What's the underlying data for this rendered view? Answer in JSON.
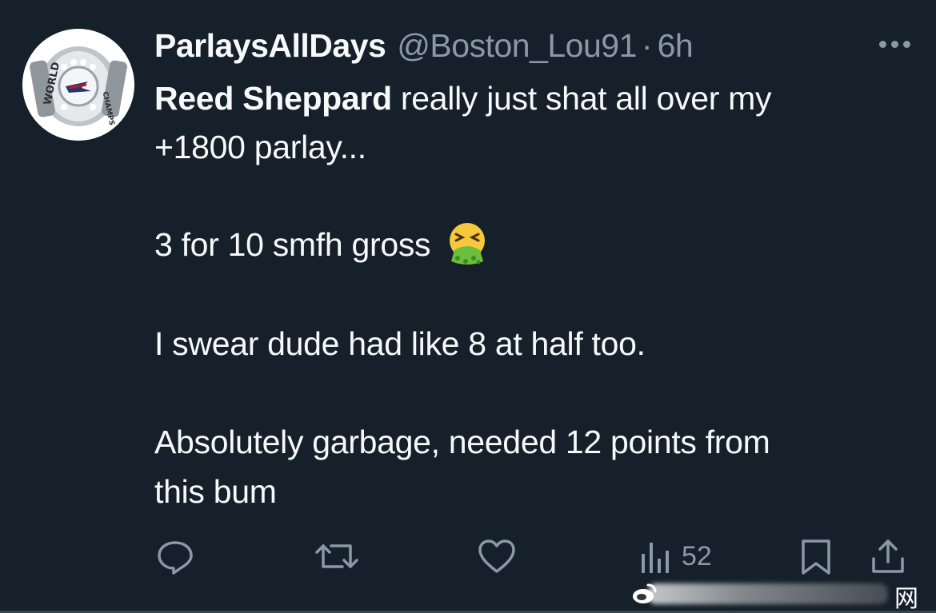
{
  "user": {
    "display_name": "ParlaysAllDays",
    "handle": "@Boston_Lou91",
    "separator": "·",
    "time": "6h",
    "avatar_icon": "championship-ring-avatar"
  },
  "tweet": {
    "mention": "Reed Sheppard",
    "line1_rest": " really just shat all over my",
    "line2": "+1800 parlay...",
    "line3": "3 for 10 smfh gross",
    "line3_emoji": "vomiting-face-emoji",
    "line4": "I swear dude had like 8 at half too.",
    "line5": "Absolutely garbage, needed 12 points from",
    "line6": "this bum"
  },
  "actions": {
    "reply_icon": "reply-icon",
    "retweet_icon": "retweet-icon",
    "like_icon": "like-icon",
    "views_icon": "views-icon",
    "views_count": "52",
    "bookmark_icon": "bookmark-icon",
    "share_icon": "share-icon"
  },
  "watermark": {
    "char": "网"
  },
  "colors": {
    "background": "#15202b",
    "primary_text": "#f7f9f9",
    "secondary_text": "#8b98a5"
  }
}
